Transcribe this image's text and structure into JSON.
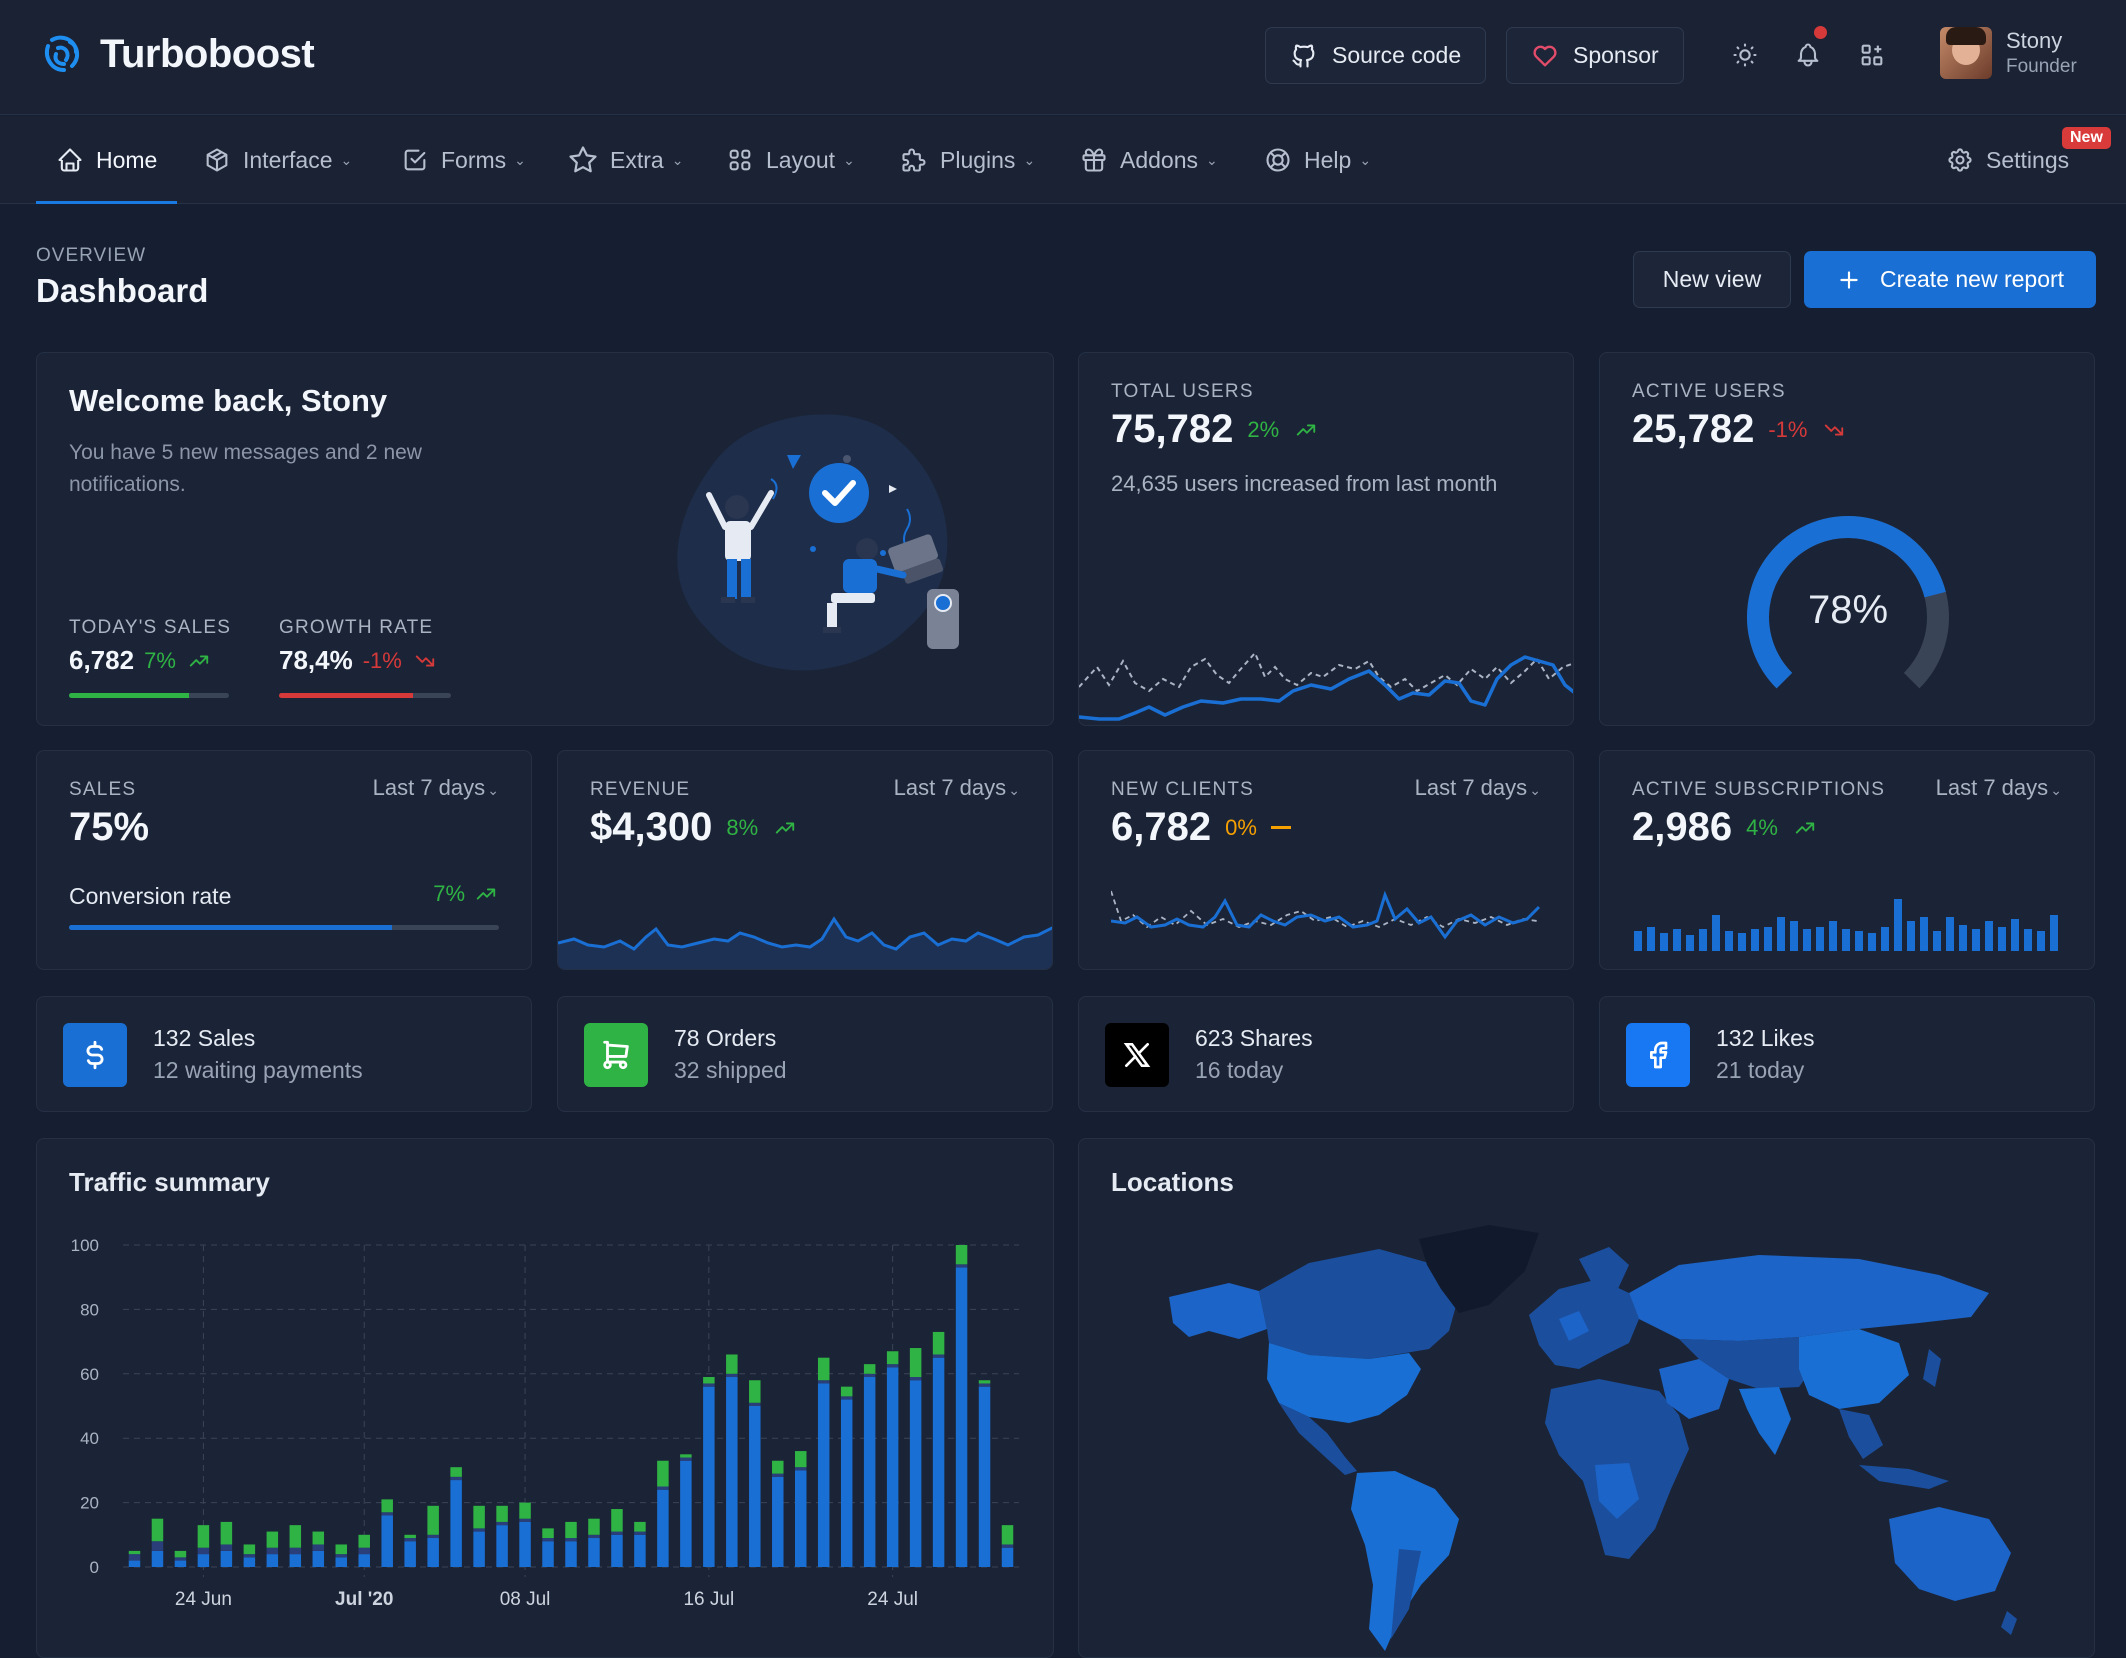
{
  "brand": {
    "name": "Turboboost"
  },
  "header": {
    "source_code": "Source code",
    "sponsor": "Sponsor",
    "user_name": "Stony",
    "user_role": "Founder"
  },
  "nav": {
    "items": [
      {
        "label": "Home",
        "icon": "home-icon"
      },
      {
        "label": "Interface",
        "icon": "package-icon"
      },
      {
        "label": "Forms",
        "icon": "checkbox-icon"
      },
      {
        "label": "Extra",
        "icon": "star-icon"
      },
      {
        "label": "Layout",
        "icon": "layout-grid-icon"
      },
      {
        "label": "Plugins",
        "icon": "puzzle-icon"
      },
      {
        "label": "Addons",
        "icon": "gift-icon"
      },
      {
        "label": "Help",
        "icon": "lifebuoy-icon"
      }
    ],
    "settings": "Settings",
    "settings_badge": "New"
  },
  "page": {
    "pretitle": "OVERVIEW",
    "title": "Dashboard",
    "new_view": "New view",
    "create_report": "Create new report"
  },
  "welcome": {
    "title": "Welcome back, Stony",
    "text": "You have 5 new messages and 2 new notifications.",
    "sales_label": "TODAY'S SALES",
    "sales_value": "6,782",
    "sales_pct": "7%",
    "sales_progress": 0.75,
    "growth_label": "GROWTH RATE",
    "growth_value": "78,4%",
    "growth_pct": "-1%",
    "growth_progress": 0.78
  },
  "total_users": {
    "label": "TOTAL USERS",
    "value": "75,782",
    "pct": "2%",
    "note": "24,635 users increased from last month"
  },
  "active_users": {
    "label": "ACTIVE USERS",
    "value": "25,782",
    "pct": "-1%",
    "gauge": "78%",
    "gauge_fraction": 0.78
  },
  "sales": {
    "label": "SALES",
    "range": "Last 7 days",
    "value": "75%",
    "conv_label": "Conversion rate",
    "conv_pct": "7%",
    "conv_progress": 0.75
  },
  "revenue": {
    "label": "REVENUE",
    "range": "Last 7 days",
    "value": "$4,300",
    "pct": "8%"
  },
  "new_clients": {
    "label": "NEW CLIENTS",
    "range": "Last 7 days",
    "value": "6,782",
    "pct": "0%"
  },
  "subscriptions": {
    "label": "ACTIVE SUBSCRIPTIONS",
    "range": "Last 7 days",
    "value": "2,986",
    "pct": "4%"
  },
  "stats": [
    {
      "title": "132 Sales",
      "sub": "12 waiting payments",
      "icon": "dollar-icon",
      "color": "#1a6fd4"
    },
    {
      "title": "78 Orders",
      "sub": "32 shipped",
      "icon": "cart-icon",
      "color": "#2fb344"
    },
    {
      "title": "623 Shares",
      "sub": "16 today",
      "icon": "x-logo-icon",
      "color": "#000000"
    },
    {
      "title": "132 Likes",
      "sub": "21 today",
      "icon": "facebook-icon",
      "color": "#1877f2"
    }
  ],
  "traffic": {
    "title": "Traffic summary"
  },
  "locations": {
    "title": "Locations"
  },
  "chart_data": {
    "type": "bar",
    "stacked": true,
    "title": "Traffic summary",
    "ylim": [
      0,
      100
    ],
    "yticks": [
      0,
      20,
      40,
      60,
      80,
      100
    ],
    "xtick_labels": [
      {
        "i": 3,
        "label": "24 Jun"
      },
      {
        "i": 10,
        "label": "Jul '20"
      },
      {
        "i": 17,
        "label": "08 Jul"
      },
      {
        "i": 25,
        "label": "16 Jul"
      },
      {
        "i": 33,
        "label": "24 Jul"
      }
    ],
    "series": [
      {
        "color": "#1a6fd4",
        "values": [
          2,
          5,
          2,
          4,
          5,
          3,
          4,
          4,
          5,
          3,
          4,
          16,
          8,
          9,
          27,
          11,
          13,
          14,
          8,
          8,
          9,
          10,
          10,
          24,
          33,
          56,
          59,
          50,
          28,
          30,
          57,
          52,
          59,
          62,
          58,
          65,
          93,
          56,
          6
        ]
      },
      {
        "color": "#2a3f7a",
        "values": [
          2,
          3,
          1,
          2,
          2,
          1,
          2,
          2,
          2,
          1,
          2,
          1,
          1,
          1,
          1,
          1,
          1,
          1,
          1,
          1,
          1,
          1,
          1,
          1,
          1,
          1,
          1,
          1,
          1,
          1,
          1,
          1,
          1,
          1,
          1,
          1,
          1,
          1,
          1
        ]
      },
      {
        "color": "#2fb344",
        "values": [
          1,
          7,
          2,
          7,
          7,
          3,
          5,
          7,
          4,
          3,
          4,
          4,
          1,
          9,
          3,
          7,
          5,
          5,
          3,
          5,
          5,
          7,
          3,
          8,
          1,
          2,
          6,
          7,
          4,
          5,
          7,
          3,
          3,
          4,
          9,
          7,
          6,
          1,
          6
        ]
      }
    ]
  }
}
